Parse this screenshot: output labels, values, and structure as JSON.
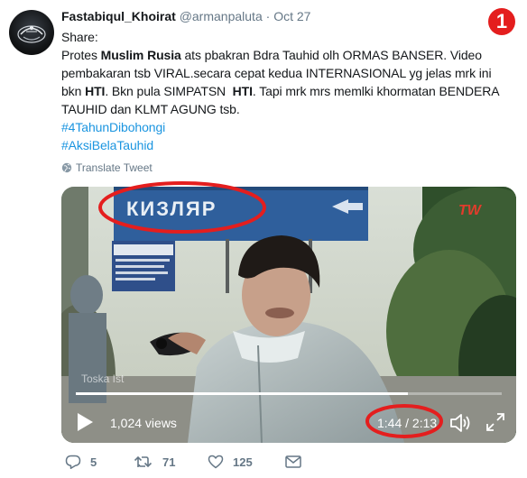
{
  "tweet": {
    "display_name": "Fastabiqul_Khoirat",
    "handle": "@armanpaluta",
    "separator": "·",
    "date": "Oct 27",
    "lines": [
      [
        "Share:"
      ],
      [
        {
          "t": "Protes "
        },
        {
          "t": "Muslim Rusia",
          "b": true
        },
        {
          "t": " ats pbakran Bdra Tauhid olh ORMAS BANSER. Video"
        }
      ],
      [
        {
          "t": "pembakaran tsb VIRAL.secara cepat kedua INTERNASIONAL yg jelas mrk ini"
        }
      ],
      [
        {
          "t": "bkn "
        },
        {
          "t": "HTI",
          "b": true
        },
        {
          "t": ". Bkn pula SIMPATSN  "
        },
        {
          "t": "HTI",
          "b": true
        },
        {
          "t": ". Tapi mrk mrs memlki khormatan BENDERA"
        }
      ],
      [
        {
          "t": "TAUHID dan KLMT AGUNG tsb."
        }
      ]
    ],
    "hashtags": [
      "#4TahunDibohongi",
      "#AksiBelaTauhid"
    ],
    "translate_label": "Translate Tweet"
  },
  "badge": {
    "number": "1",
    "color": "#e41e1e"
  },
  "video": {
    "sign_text": "КИЗЛЯР",
    "channel_logo": "TW",
    "watermark": "Toska Ist",
    "views": "1,024 views",
    "time": "1:44 / 2:13",
    "progress_fraction": 0.78
  },
  "actions": {
    "replies": "5",
    "retweets": "71",
    "likes": "125"
  },
  "colors": {
    "link": "#1b95e0",
    "muted": "#657786",
    "annotation_red": "#e41e1e"
  }
}
